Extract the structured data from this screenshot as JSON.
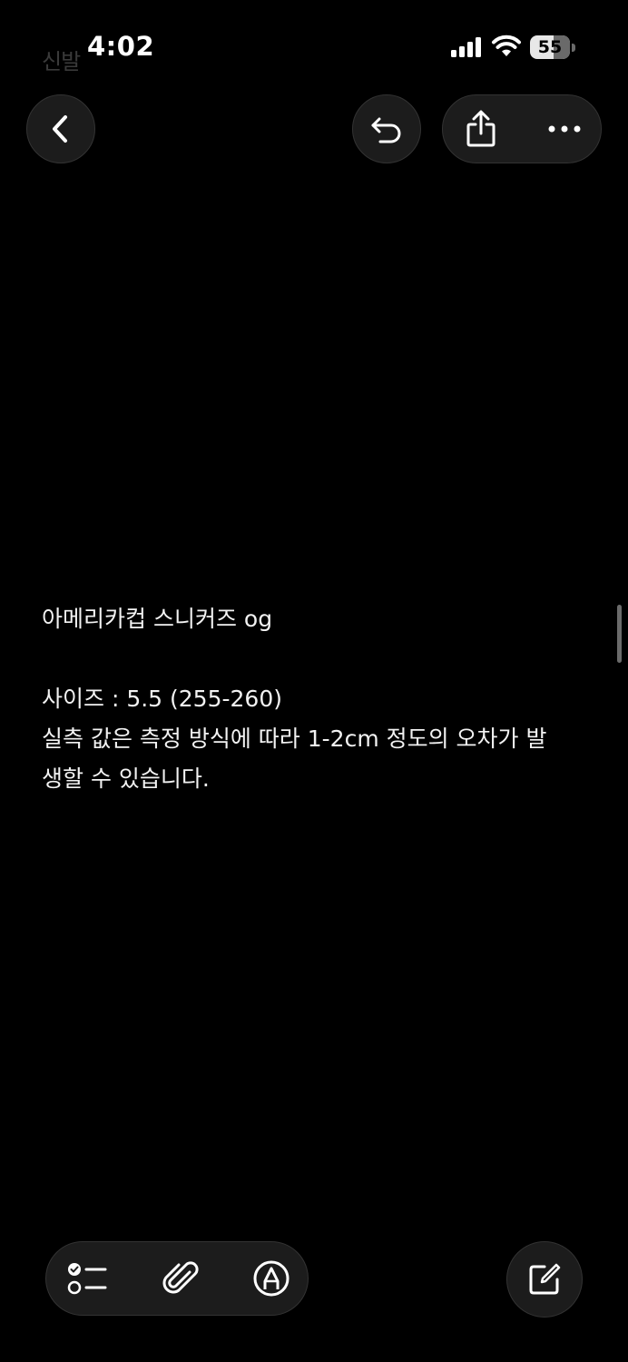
{
  "status_bar": {
    "time": "4:02",
    "background_title": "신발",
    "battery_level": "55"
  },
  "toolbar_top": {
    "back_icon": "chevron-left-icon",
    "undo_icon": "undo-icon",
    "share_icon": "share-icon",
    "more_icon": "ellipsis-icon"
  },
  "note": {
    "title": "아메리카컵 스니커즈 og",
    "lines": [
      "사이즈 : 5.5 (255-260)",
      "실측 값은 측정 방식에 따라 1-2cm 정도의 오차가 발",
      "생할 수 있습니다."
    ]
  },
  "toolbar_bottom": {
    "checklist_icon": "checklist-icon",
    "attach_icon": "paperclip-icon",
    "markup_icon": "markup-pen-icon",
    "compose_icon": "compose-icon"
  },
  "colors": {
    "background": "#000000",
    "button_bg": "#1c1c1c",
    "text": "#f2f2f2"
  }
}
